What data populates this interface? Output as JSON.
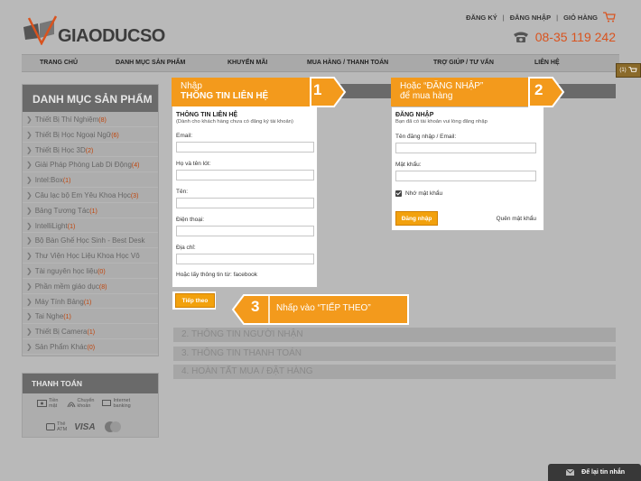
{
  "logo": {
    "text": "GIAODUCSO"
  },
  "toplinks": {
    "register": "ĐĂNG KÝ",
    "sep1": "|",
    "login": "ĐĂNG NHẬP",
    "sep2": "|",
    "cart": "GIỎ HÀNG"
  },
  "phone": {
    "number": "08-35 119 242"
  },
  "nav": {
    "items": [
      "TRANG CHỦ",
      "DANH MỤC SẢN PHẨM",
      "KHUYẾN MÃI",
      "MUA HÀNG / THANH TOÁN",
      "TRỢ GIÚP / TƯ VẤN",
      "LIÊN HỆ"
    ]
  },
  "side_cart": {
    "count": "(1)"
  },
  "sidebar": {
    "title": "DANH MỤC SẢN PHẨM",
    "items": [
      {
        "label": "Thiết Bị Thí Nghiệm",
        "count": "(8)"
      },
      {
        "label": "Thiết Bị Học Ngoại Ngữ",
        "count": "(6)"
      },
      {
        "label": "Thiết Bị Học 3D",
        "count": "(2)"
      },
      {
        "label": "Giải Pháp Phòng Lab Di Động",
        "count": "(4)"
      },
      {
        "label": "Intel:Box",
        "count": "(1)"
      },
      {
        "label": "Câu lạc bộ Em Yêu Khoa Học",
        "count": "(3)"
      },
      {
        "label": "Bảng Tương Tác",
        "count": "(1)"
      },
      {
        "label": "IntelliLight",
        "count": "(1)"
      },
      {
        "label": "Bộ Bàn Ghế Học Sinh - Best Desk",
        "count": ""
      },
      {
        "label": "Thư Viện Học Liệu Khoa Học Vô",
        "count": ""
      },
      {
        "label": "Tài nguyên học liệu",
        "count": "(0)"
      },
      {
        "label": "Phần mềm giáo dục",
        "count": "(8)"
      },
      {
        "label": "Máy Tính Bảng",
        "count": "(1)"
      },
      {
        "label": "Tai Nghe",
        "count": "(1)"
      },
      {
        "label": "Thiết Bị Camera",
        "count": "(1)"
      },
      {
        "label": "Sản Phẩm Khác",
        "count": "(0)"
      }
    ]
  },
  "payment": {
    "title": "THANH TOÁN",
    "row1": [
      {
        "l1": "Tiền",
        "l2": "mặt"
      },
      {
        "l1": "Chuyển",
        "l2": "khoản"
      },
      {
        "l1": "Internet",
        "l2": "banking"
      }
    ],
    "atm": {
      "l1": "Thẻ",
      "l2": "ATM"
    },
    "visa": "VISA"
  },
  "form1": {
    "title": "THÔNG TIN LIÊN HỆ",
    "subtitle": "(Dành cho khách hàng chưa có đăng ký tài khoản)",
    "fields": [
      "Email:",
      "Họ và tên lót:",
      "Tên:",
      "Điện thoại:",
      "Địa chỉ:"
    ],
    "note": "Hoặc lấy thông tin từ: facebook",
    "next_button": "Tiếp theo"
  },
  "form2": {
    "title": "ĐĂNG NHẬP",
    "subtitle": "Bạn đã có tài khoản vui lòng đăng nhập",
    "username_label": "Tên đăng nhập / Email:",
    "password_label": "Mật khẩu:",
    "remember": "Nhớ mật khẩu",
    "login_button": "Đăng nhập",
    "forgot": "Quên mật khẩu"
  },
  "steps": [
    "2. THÔNG TIN NGƯỜI NHẬN",
    "3. THÔNG TIN THANH TOÁN",
    "4. HOÀN TẤT MUA / ĐẶT HÀNG"
  ],
  "callouts": {
    "c1": {
      "line1": "Nhập",
      "line2": "THÔNG TIN LIÊN HỆ",
      "num": "1"
    },
    "c2": {
      "line1": "Hoặc “ĐĂNG NHẬP”",
      "line2": "để mua hàng",
      "num": "2"
    },
    "c3": {
      "text": "Nhấp vào “TIẾP THEO”",
      "num": "3"
    }
  },
  "chat": {
    "label": "Để lại tin nhắn"
  },
  "colors": {
    "accent": "#f39a1c",
    "phone": "#d9531e",
    "bg": "#b9b9b9"
  }
}
